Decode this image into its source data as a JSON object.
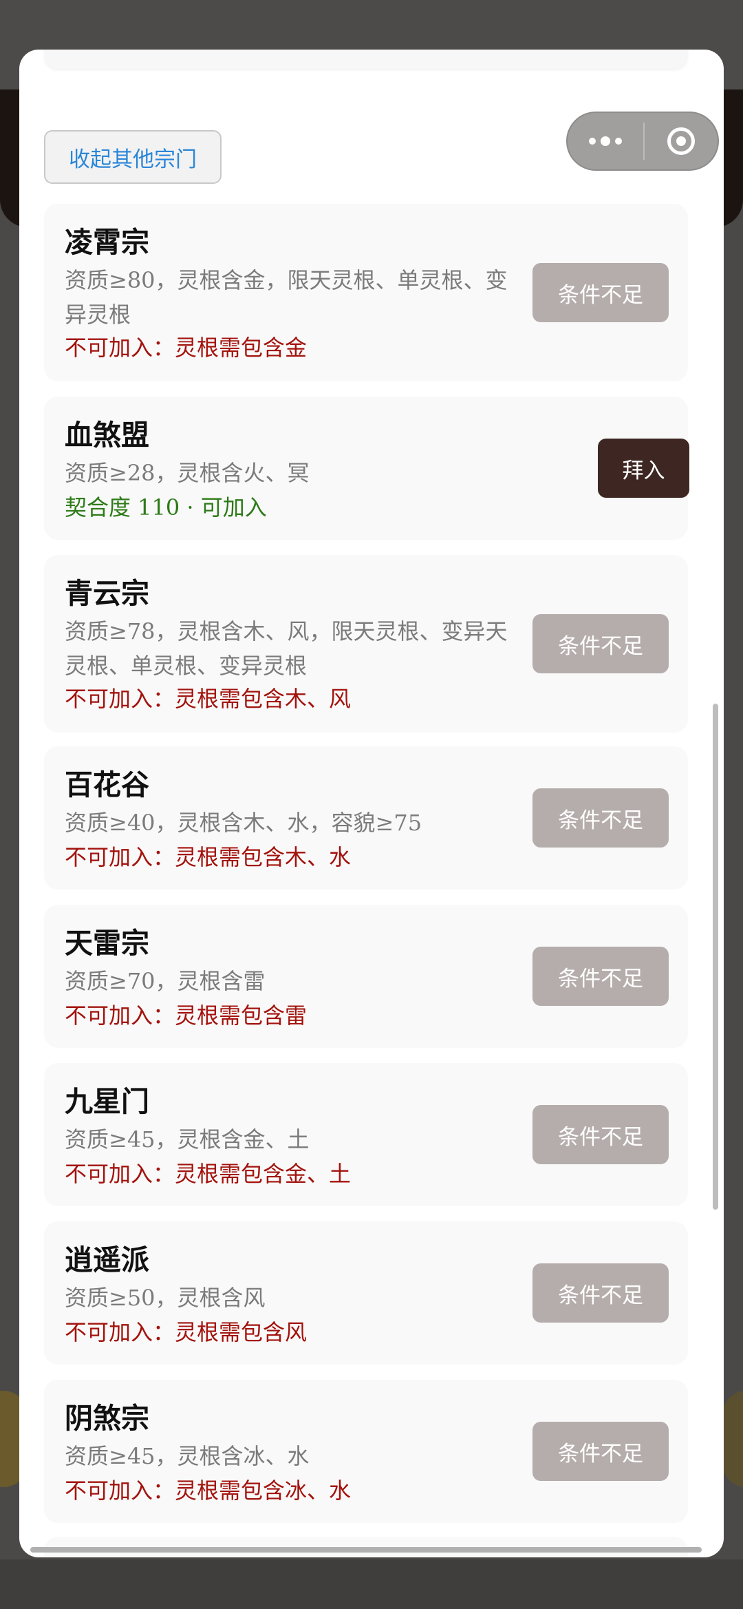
{
  "header": {
    "collapse_label": "收起其他宗门"
  },
  "sects": [
    {
      "name": "凌霄宗",
      "requirement": "资质≥80，灵根含金，限天灵根、单灵根、变异灵根",
      "status": "不可加入：灵根需包含金",
      "button": "条件不足"
    },
    {
      "name": "血煞盟",
      "requirement": "资质≥28，灵根含火、冥",
      "status": "契合度 110 · 可加入",
      "button": "拜入"
    },
    {
      "name": "青云宗",
      "requirement": "资质≥78，灵根含木、风，限天灵根、变异天灵根、单灵根、变异灵根",
      "status": "不可加入：灵根需包含木、风",
      "button": "条件不足"
    },
    {
      "name": "百花谷",
      "requirement": "资质≥40，灵根含木、水，容貌≥75",
      "status": "不可加入：灵根需包含木、水",
      "button": "条件不足"
    },
    {
      "name": "天雷宗",
      "requirement": "资质≥70，灵根含雷",
      "status": "不可加入：灵根需包含雷",
      "button": "条件不足"
    },
    {
      "name": "九星门",
      "requirement": "资质≥45，灵根含金、土",
      "status": "不可加入：灵根需包含金、土",
      "button": "条件不足"
    },
    {
      "name": "逍遥派",
      "requirement": "资质≥50，灵根含风",
      "status": "不可加入：灵根需包含风",
      "button": "条件不足"
    },
    {
      "name": "阴煞宗",
      "requirement": "资质≥45，灵根含冰、水",
      "status": "不可加入：灵根需包含冰、水",
      "button": "条件不足"
    }
  ],
  "colors": {
    "status_bad": "#a3130d",
    "status_good": "#2d7a18",
    "join_button": "#3e2723",
    "disabled_button": "#b5adab",
    "link_blue": "#2a86d8"
  }
}
